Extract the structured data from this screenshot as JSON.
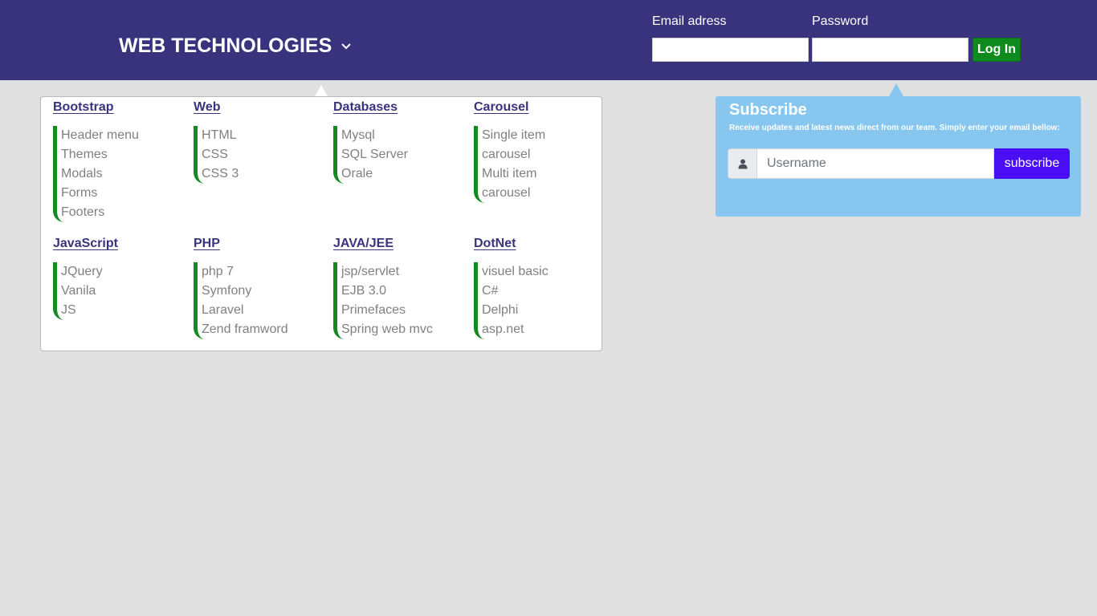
{
  "header": {
    "brand": "WEB TECHNOLOGIES",
    "brand_icon": "chevron-down-icon",
    "email_label": "Email adress",
    "email_value": "",
    "password_label": "Password",
    "password_value": "",
    "login_label": "Log In"
  },
  "menu": {
    "categories": [
      {
        "title": "Bootstrap",
        "items": [
          "Header menu",
          "Themes",
          "Modals",
          "Forms",
          "Footers"
        ]
      },
      {
        "title": "Web",
        "items": [
          "HTML",
          "CSS",
          "CSS 3"
        ]
      },
      {
        "title": "Databases",
        "items": [
          "Mysql",
          "SQL Server",
          "Orale"
        ]
      },
      {
        "title": "Carousel",
        "items": [
          "Single item",
          "carousel",
          "Multi item",
          "carousel"
        ]
      },
      {
        "title": "JavaScript",
        "items": [
          "JQuery",
          "Vanila",
          "JS"
        ]
      },
      {
        "title": "PHP",
        "items": [
          "php 7",
          "Symfony",
          "Laravel",
          "Zend framword"
        ]
      },
      {
        "title": "JAVA/JEE",
        "items": [
          "jsp/servlet",
          "EJB 3.0",
          "Primefaces",
          "Spring web mvc"
        ]
      },
      {
        "title": "DotNet",
        "items": [
          "visuel basic",
          "C#",
          "Delphi",
          "asp.net"
        ]
      }
    ]
  },
  "subscribe": {
    "title": "Subscribe",
    "description": "Receive updates and latest news direct from our team. Simply enter your email bellow:",
    "placeholder": "Username",
    "icon": "user-icon",
    "button_label": "subscribe"
  },
  "colors": {
    "header_bg": "#39337e",
    "accent_green": "#138a22",
    "subscribe_bg": "#87c6ee",
    "subscribe_button": "#4a0ef5",
    "page_bg": "#e0e0e0"
  }
}
